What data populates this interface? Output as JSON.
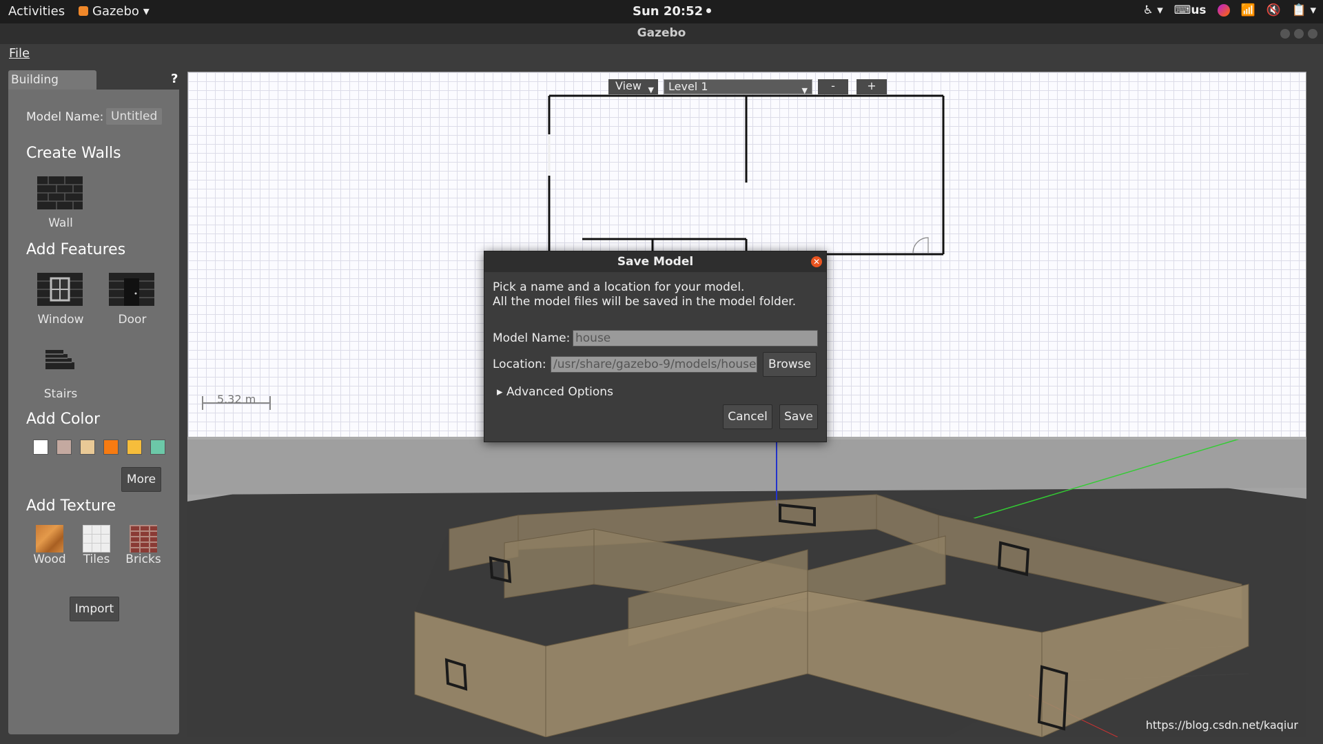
{
  "topbar": {
    "activities": "Activities",
    "app_name": "Gazebo",
    "clock": "Sun 20:52",
    "keyboard_layout": "us"
  },
  "window": {
    "title": "Gazebo"
  },
  "menubar": {
    "file": "File"
  },
  "left_panel": {
    "tab_title": "Building Editor",
    "help": "?",
    "model_name_label": "Model Name:",
    "model_name_value": "Untitled",
    "create_walls": "Create Walls",
    "wall": "Wall",
    "add_features": "Add Features",
    "window": "Window",
    "door": "Door",
    "stairs": "Stairs",
    "add_color": "Add Color",
    "colors": [
      "#ffffff",
      "#c4a9a0",
      "#e9c996",
      "#f77b12",
      "#f6bd3b",
      "#6cc8a8"
    ],
    "more": "More",
    "add_texture": "Add Texture",
    "wood": "Wood",
    "tiles": "Tiles",
    "bricks": "Bricks",
    "import": "Import"
  },
  "editor2d": {
    "view_btn": "View",
    "level": "Level 1",
    "zoom_out": "-",
    "zoom_in": "+",
    "scale": "5.32 m"
  },
  "dialog": {
    "title": "Save Model",
    "line1": "Pick a name and a location for your model.",
    "line2": "All the model files will be saved in the model folder.",
    "name_label": "Model Name:",
    "name_value": "house",
    "location_label": "Location:",
    "location_value": "/usr/share/gazebo-9/models/house",
    "browse": "Browse",
    "advanced": "Advanced Options",
    "cancel": "Cancel",
    "save": "Save"
  },
  "watermark": "https://blog.csdn.net/kaqiur"
}
